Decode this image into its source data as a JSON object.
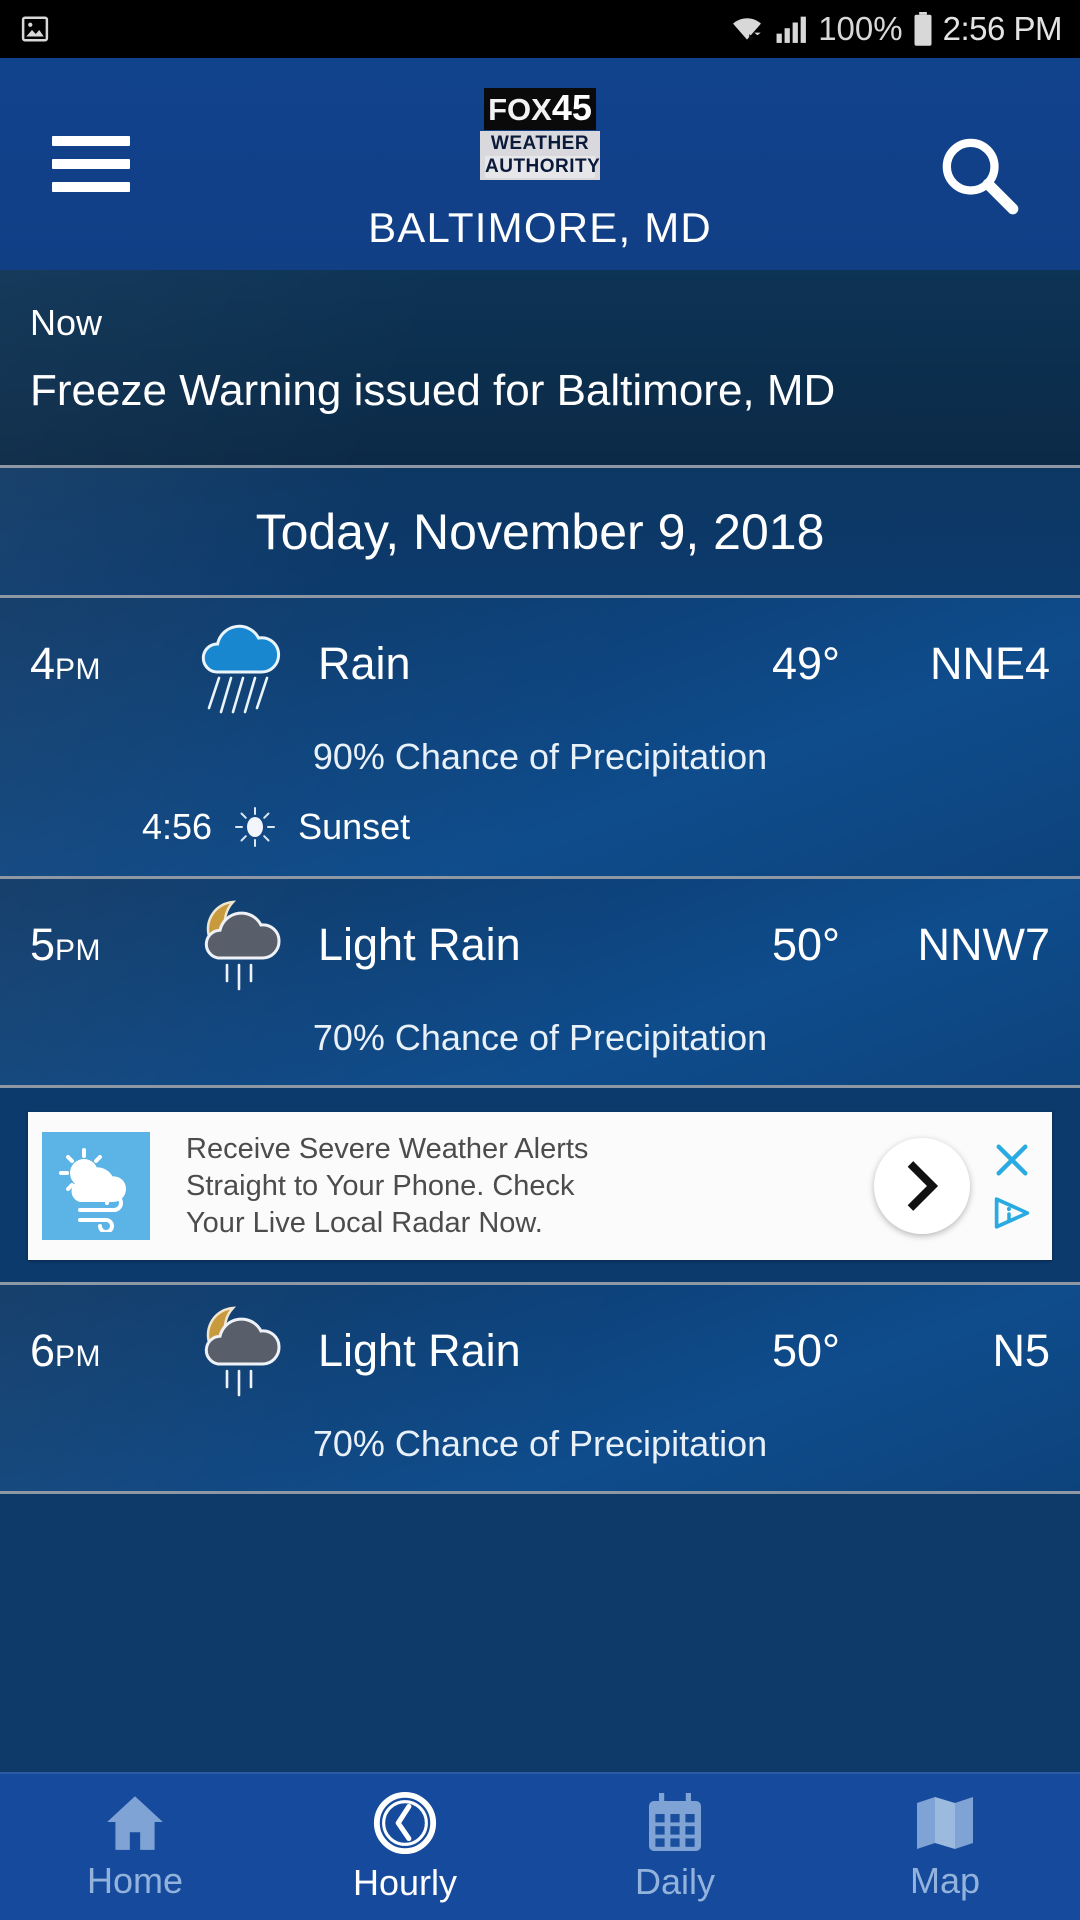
{
  "statusbar": {
    "left_icon": "image-icon",
    "wifi_icon": "wifi-icon",
    "signal_icon": "cellular-signal-icon",
    "battery_percent": "100%",
    "battery_icon": "battery-icon",
    "clock": "2:56 PM"
  },
  "appbar": {
    "menu_icon": "hamburger-menu-icon",
    "search_icon": "search-icon",
    "logo_fox": "FOX",
    "logo_45": "45",
    "logo_weather": "WEATHER",
    "logo_authority": "AUTHORITY",
    "city": "BALTIMORE, MD",
    "bg_color": "#11428c"
  },
  "alert": {
    "time_label": "Now",
    "message": "Freeze Warning issued for Baltimore, MD"
  },
  "date_header": {
    "label": "Today, November 9, 2018"
  },
  "hours": [
    {
      "time": "4",
      "meridiem": "PM",
      "icon": "rain-cloud-icon",
      "condition": "Rain",
      "temp": "49°",
      "wind": "NNE4",
      "precip": "90% Chance of Precipitation",
      "sun_time": "4:56",
      "sun_icon": "sunset-icon",
      "sun_label": "Sunset"
    },
    {
      "time": "5",
      "meridiem": "PM",
      "icon": "moon-cloud-light-rain-icon",
      "condition": "Light Rain",
      "temp": "50°",
      "wind": "NNW7",
      "precip": "70% Chance of Precipitation"
    },
    {
      "time": "6",
      "meridiem": "PM",
      "icon": "moon-cloud-light-rain-icon",
      "condition": "Light Rain",
      "temp": "50°",
      "wind": "N5",
      "precip": "70% Chance of Precipitation"
    }
  ],
  "ad": {
    "thumb_icon": "sun-cloud-wind-icon",
    "line1": "Receive Severe Weather Alerts",
    "line2": "Straight to Your Phone. Check",
    "line3": "Your Live Local Radar Now.",
    "arrow_icon": "chevron-right-icon",
    "close_icon": "close-x-icon",
    "adchoices_icon": "adchoices-icon",
    "accent_color": "#29abe2"
  },
  "tabbar": {
    "items": [
      {
        "label": "Home",
        "icon": "home-icon",
        "active": false
      },
      {
        "label": "Hourly",
        "icon": "clock-icon",
        "active": true
      },
      {
        "label": "Daily",
        "icon": "calendar-icon",
        "active": false
      },
      {
        "label": "Map",
        "icon": "map-icon",
        "active": false
      }
    ]
  }
}
